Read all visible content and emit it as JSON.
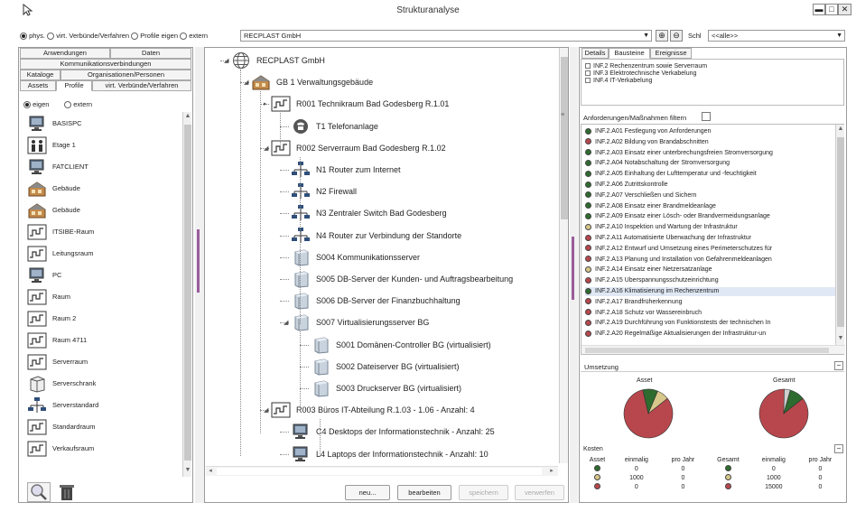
{
  "window": {
    "title": "Strukturanalyse"
  },
  "toolbar": {
    "radio_phys": "phys.",
    "radio_virt": "virt. Verbünde/Verfahren",
    "radio_profile": "Profile eigen",
    "radio_extern": "extern",
    "company_select": "RECPLAST GmbH",
    "search_label": "Schl",
    "search_value": "<<alle>>"
  },
  "left": {
    "tabs_row1": [
      "Anwendungen",
      "Daten"
    ],
    "tabs_row2": [
      "Kommunikationsverbindungen"
    ],
    "tabs_row3": [
      "Kataloge",
      "Organisationen/Personen"
    ],
    "tabs_row4": [
      "Assets",
      "Profile",
      "virt. Verbünde/Verfahren"
    ],
    "radio_own": "eigen",
    "radio_ext": "extern",
    "items": [
      {
        "label": "BASISPC",
        "icon": "pc-icon"
      },
      {
        "label": "Etage 1",
        "icon": "floor-icon"
      },
      {
        "label": "FATCLIENT",
        "icon": "pc-icon"
      },
      {
        "label": "Gebäude",
        "icon": "building-icon"
      },
      {
        "label": "Gebäude",
        "icon": "building-icon"
      },
      {
        "label": "ITSIBE-Raum",
        "icon": "room-icon"
      },
      {
        "label": "Leitungsraum",
        "icon": "room-icon"
      },
      {
        "label": "PC",
        "icon": "pc-icon"
      },
      {
        "label": "Raum",
        "icon": "room-icon"
      },
      {
        "label": "Raum 2",
        "icon": "room-icon"
      },
      {
        "label": "Raum 4711",
        "icon": "room-icon"
      },
      {
        "label": "Serverraum",
        "icon": "room-icon"
      },
      {
        "label": "Serverschrank",
        "icon": "rack-icon"
      },
      {
        "label": "Serverstandard",
        "icon": "network-icon"
      },
      {
        "label": "Standardraum",
        "icon": "room-icon"
      },
      {
        "label": "Verkaufsraum",
        "icon": "room-icon"
      }
    ]
  },
  "tree": {
    "root": "RECPLAST GmbH",
    "nodes": [
      {
        "label": "GB 1 Verwaltungsgebäude",
        "icon": "building-icon"
      },
      {
        "label": "R001 Technikraum Bad Godesberg R.1.01",
        "icon": "room-icon"
      },
      {
        "label": "T1 Telefonanlage",
        "icon": "phone-icon"
      },
      {
        "label": "R002 Serverraum Bad Godesberg R.1.02",
        "icon": "room-icon"
      },
      {
        "label": "N1 Router zum Internet",
        "icon": "network-icon"
      },
      {
        "label": "N2 Firewall",
        "icon": "network-icon"
      },
      {
        "label": "N3 Zentraler Switch Bad Godesberg",
        "icon": "network-icon"
      },
      {
        "label": "N4 Router zur Verbindung der Standorte",
        "icon": "network-icon"
      },
      {
        "label": "S004 Kommunikationsserver",
        "icon": "server-icon"
      },
      {
        "label": "S005 DB-Server der Kunden- und Auftragsbearbeitung",
        "icon": "server-icon"
      },
      {
        "label": "S006 DB-Server der Finanzbuchhaltung",
        "icon": "server-icon"
      },
      {
        "label": "S007 Virtualisierungsserver BG",
        "icon": "server-icon"
      },
      {
        "label": "S001 Domänen-Controller BG (virtualisiert)",
        "icon": "server-icon"
      },
      {
        "label": "S002 Dateiserver BG (virtualisiert)",
        "icon": "server-icon"
      },
      {
        "label": "S003 Druckserver BG (virtualisiert)",
        "icon": "server-icon"
      },
      {
        "label": "R003 Büros IT-Abteilung R.1.03 - 1.06 - Anzahl: 4",
        "icon": "room-icon"
      },
      {
        "label": "C4 Desktops der Informationstechnik - Anzahl: 25",
        "icon": "pc-icon"
      },
      {
        "label": "L4 Laptops der Informationstechnik - Anzahl: 10",
        "icon": "pc-icon"
      }
    ],
    "buttons": {
      "new": "neu...",
      "edit": "bearbeiten",
      "save": "speichern",
      "discard": "verwerfen"
    }
  },
  "right": {
    "tabs": [
      "Details",
      "Bausteine",
      "Ereignisse"
    ],
    "modules": [
      "INF.2 Rechenzentrum sowie Serverraum",
      "INF.3 Elektrotechnische Verkabelung",
      "INF.4 IT-Verkabelung"
    ],
    "filter_label": "Anforderungen/Maßnahmen filtern",
    "measures": [
      {
        "label": "INF.2.A01 Festlegung von Anforderungen",
        "status": "green"
      },
      {
        "label": "INF.2.A02 Bildung von Brandabschnitten",
        "status": "red"
      },
      {
        "label": "INF.2.A03 Einsatz einer unterbrechungsfreien Stromversorgung",
        "status": "green"
      },
      {
        "label": "INF.2.A04 Notabschaltung der Stromversorgung",
        "status": "green"
      },
      {
        "label": "INF.2.A05 Einhaltung der Lufttemperatur und -feuchtigkeit",
        "status": "green"
      },
      {
        "label": "INF.2.A06 Zutrittskontrolle",
        "status": "green"
      },
      {
        "label": "INF.2.A07 Verschließen und Sichern",
        "status": "green"
      },
      {
        "label": "INF.2.A08 Einsatz einer Brandmeldeanlage",
        "status": "green"
      },
      {
        "label": "INF.2.A09 Einsatz einer Lösch- oder Brandvermeidungsanlage",
        "status": "green"
      },
      {
        "label": "INF.2.A10 Inspektion und Wartung der Infrastruktur",
        "status": "yellow"
      },
      {
        "label": "INF.2.A11 Automatisierte Überwachung der Infrastruktur",
        "status": "red"
      },
      {
        "label": "INF.2.A12 Entwurf und Umsetzung eines Perimeterschutzes für",
        "status": "red"
      },
      {
        "label": "INF.2.A13 Planung und Installation von Gefahrenmeldeanlagen",
        "status": "red"
      },
      {
        "label": "INF.2.A14 Einsatz einer Netzersatzanlage",
        "status": "yellow"
      },
      {
        "label": "INF.2.A15 Überspannungsschutzeinrichtung",
        "status": "red"
      },
      {
        "label": "INF.2.A16 Klimatisierung im Rechenzentrum",
        "status": "green"
      },
      {
        "label": "INF.2.A17 Brandfrüherkennung",
        "status": "red"
      },
      {
        "label": "INF.2.A18 Schutz vor Wassereinbruch",
        "status": "red"
      },
      {
        "label": "INF.2.A19 Durchführung von Funktionstests der technischen In",
        "status": "red"
      },
      {
        "label": "INF.2.A20 Regelmäßige Aktualisierungen der Infrastruktur-un",
        "status": "red"
      }
    ],
    "umsetzung_label": "Umsetzung",
    "pie_asset_label": "Asset",
    "pie_total_label": "Gesamt",
    "pie_asset": [
      {
        "status": "red",
        "value": 0.82
      },
      {
        "status": "green",
        "value": 0.1
      },
      {
        "status": "yellow",
        "value": 0.08
      }
    ],
    "pie_total": [
      {
        "status": "red",
        "value": 0.86
      },
      {
        "status": "gray",
        "value": 0.04
      },
      {
        "status": "green",
        "value": 0.1
      }
    ],
    "costs": {
      "label": "Kosten",
      "headers": [
        "Asset",
        "einmalig",
        "pro Jahr",
        "Gesamt",
        "einmalig",
        "pro Jahr"
      ],
      "rows": [
        {
          "status": "green",
          "asset_once": "0",
          "asset_year": "0",
          "total_once": "0",
          "total_year": "0"
        },
        {
          "status": "yellow",
          "asset_once": "1000",
          "asset_year": "0",
          "total_once": "1000",
          "total_year": "0"
        },
        {
          "status": "red",
          "asset_once": "0",
          "asset_year": "0",
          "total_once": "15000",
          "total_year": "0"
        }
      ]
    }
  },
  "colors": {
    "green": "#2e6b2e",
    "red": "#b8474d",
    "yellow": "#d8c78a",
    "gray": "#cfcfcf",
    "selection": "#dfe8f4"
  }
}
